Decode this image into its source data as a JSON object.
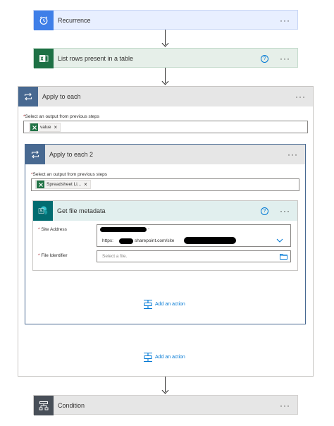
{
  "colors": {
    "recurrence_tile": "#3f7fe8",
    "recurrence_bg": "#e8efff",
    "excel_tile": "#1e7145",
    "excel_bg": "#e6efe9",
    "loop_tile": "#486991",
    "loop_bg": "#e6e6e6",
    "sharepoint_tile": "#036c70",
    "sharepoint_bg": "#e1efee",
    "condition_tile": "#484f58",
    "link": "#0078d4"
  },
  "steps": {
    "recurrence": {
      "title": "Recurrence",
      "icon": "alarm-clock-icon",
      "more": "···"
    },
    "list_rows": {
      "title": "List rows present in a table",
      "icon": "excel-icon",
      "help": "?",
      "more": "···"
    },
    "apply_each": {
      "title": "Apply to each",
      "icon": "loop-icon",
      "more": "···",
      "select_label": "Select an output from previous steps",
      "token": "value",
      "add_action": "Add an action"
    },
    "apply_each_2": {
      "title": "Apply to each 2",
      "icon": "loop-icon",
      "more": "···",
      "select_label": "Select an output from previous steps",
      "token": "Spreadsheet Li...",
      "add_action": "Add an action"
    },
    "get_metadata": {
      "title": "Get file metadata",
      "icon": "sharepoint-icon",
      "help": "?",
      "more": "···",
      "site_label": "Site Address",
      "site_value_suffix": "-",
      "site_url_prefix": "https:",
      "site_url_mid": "sharepoint.com/site",
      "file_label": "File Identifier",
      "file_placeholder": "Select a file."
    },
    "condition": {
      "title": "Condition",
      "icon": "condition-icon",
      "more": "···"
    }
  },
  "required_mark": "*"
}
